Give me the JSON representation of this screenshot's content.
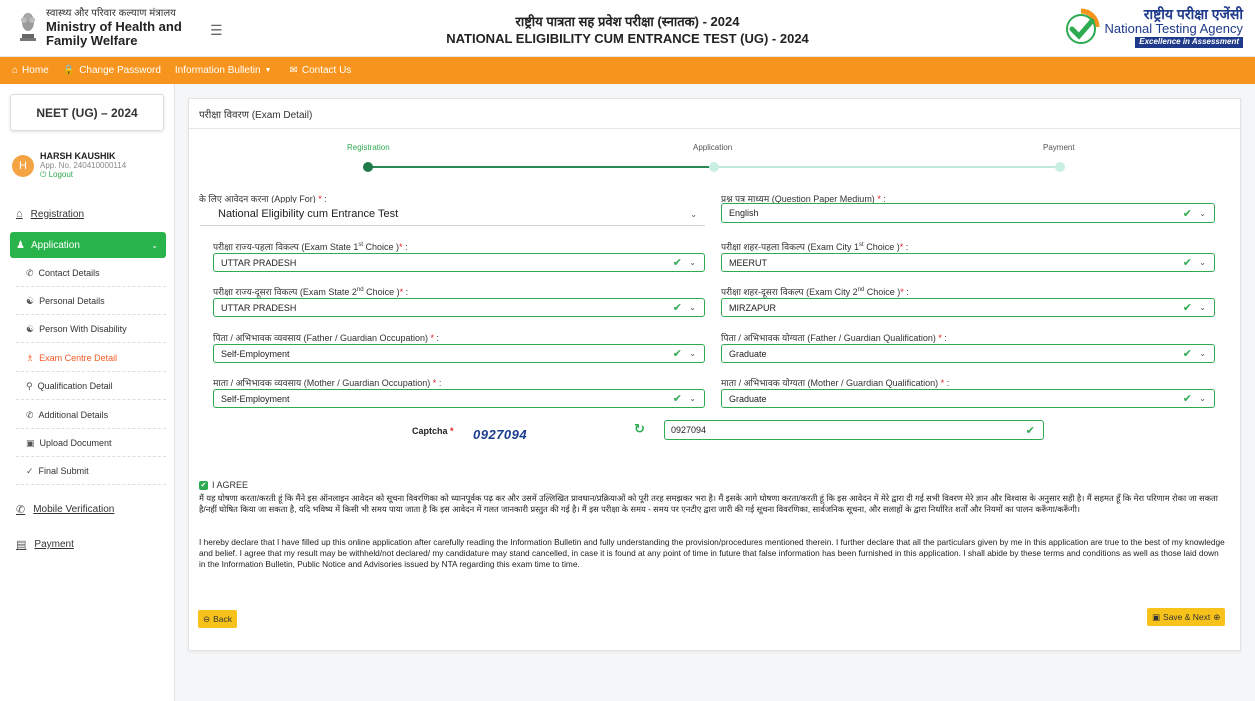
{
  "header": {
    "ministry_hindi": "स्वास्थ्य और परिवार कल्याण मंत्रालय",
    "ministry_line1": "Ministry of Health and",
    "ministry_line2": "Family Welfare",
    "title_hindi": "राष्ट्रीय पात्रता सह प्रवेश परीक्षा (स्नातक) - 2024",
    "title_en": "NATIONAL ELIGIBILITY CUM ENTRANCE TEST (UG) - 2024",
    "nta_hindi": "राष्ट्रीय परीक्षा एजेंसी",
    "nta_en": "National Testing Agency",
    "nta_tagline": "Excellence in Assessment"
  },
  "nav": {
    "home": "Home",
    "change_password": "Change Password",
    "info_bulletin": "Information Bulletin",
    "contact_us": "Contact Us"
  },
  "sidebar": {
    "exam_title": "NEET (UG) – 2024",
    "user_initial": "H",
    "user_name": "HARSH KAUSHIK",
    "app_no": "App. No. 240410000114",
    "logout": "Logout",
    "registration": "Registration",
    "application": "Application",
    "sub_items": [
      "Contact Details",
      "Personal Details",
      "Person With Disability",
      "Exam Centre Detail",
      "Qualification Detail",
      "Additional Details",
      "Upload Document",
      "Final Submit"
    ],
    "mobile_verification": "Mobile Verification",
    "payment": "Payment"
  },
  "card": {
    "title": "परीक्षा विवरण (Exam Detail)"
  },
  "steps": {
    "registration": "Registration",
    "application": "Application",
    "payment": "Payment"
  },
  "form": {
    "apply_for_label": "के लिए आवेदन करना (Apply For)",
    "apply_for_value": "National Eligibility cum Entrance Test",
    "medium_label": "प्रश्न पत्र माध्यम (Question Paper Medium)",
    "medium_value": "English",
    "state1_label_pre": "परीक्षा राज्य-पहला विकल्प (Exam State 1",
    "state1_sup": "st",
    "state1_label_post": " Choice )",
    "state1_value": "UTTAR PRADESH",
    "city1_label_pre": "परीक्षा शहर-पहला विकल्प (Exam City 1",
    "city1_sup": "st",
    "city1_label_post": " Choice )",
    "city1_value": "MEERUT",
    "state2_label_pre": "परीक्षा राज्य-दूसरा विकल्प (Exam State 2",
    "state2_sup": "nd",
    "state2_label_post": " Choice )",
    "state2_value": "UTTAR PRADESH",
    "city2_label_pre": "परीक्षा शहर-दूसरा विकल्प (Exam City 2",
    "city2_sup": "nd",
    "city2_label_post": " Choice )",
    "city2_value": "MIRZAPUR",
    "father_occ_label": "पिता / अभिभावक व्यवसाय (Father / Guardian Occupation)",
    "father_occ_value": "Self-Employment",
    "father_qual_label": "पिता / अभिभावक योग्यता (Father / Guardian Qualification)",
    "father_qual_value": "Graduate",
    "mother_occ_label": "माता / अभिभावक व्यवसाय (Mother / Guardian Occupation)",
    "mother_occ_value": "Self-Employment",
    "mother_qual_label": "माता / अभिभावक योग्यता (Mother / Guardian Qualification)",
    "mother_qual_value": "Graduate",
    "required_mark": "*",
    "colon": " :",
    "captcha_label": "Captcha",
    "captcha_text": "0927094",
    "captcha_value": "0927094"
  },
  "declaration": {
    "agree_label": "I AGREE",
    "hindi": "मैं यह घोषणा करता/करती हूं कि मैंने इस ऑनलाइन आवेदन को सूचना विवरणिका को ध्यानपूर्वक पढ़ कर और उसमें उल्लिखित प्रावधान/प्रक्रियाओं को पूरी तरह समझकर भरा है। मैं इसके आगे घोषणा करता/करती हूं कि इस आवेदन में मेरे द्वारा दी गई सभी विवरण मेरे ज्ञान और विश्वास के अनुसार सही है। मैं सहमत हूँ कि मेरा परिणाम रोका जा सकता है/नहीं घोषित किया जा सकता है, यदि भविष्य में किसी भी समय पाया जाता है कि इस आवेदन में गलत जानकारी प्रस्तुत की गई है। मैं इस परीक्षा के समय - समय पर एनटीए द्वारा जारी की गई सूचना विवरणिका, सार्वजनिक सूचना, और सलाहों के द्वारा निर्धारित शर्तों और नियमों का पालन करूँगा/करूँगी।",
    "english": "I hereby declare that I have filled up this online application after carefully reading the Information Bulletin and fully understanding the provision/procedures mentioned therein. I further declare that all the particulars given by me in this application are true to the best of my knowledge and belief. I agree that my result may be withheld/not declared/ my candidature may stand cancelled, in case it is found at any point of time in future that false information has been furnished in this application. I shall abide by these terms and conditions as well as those laid down in the Information Bulletin, Public Notice and Advisories issued by NTA regarding this exam time to time."
  },
  "buttons": {
    "back": "Back",
    "save_next": "Save & Next"
  },
  "colors": {
    "orange": "#f7941d",
    "green": "#2eaa51",
    "yellow": "#f7c31a",
    "active_sub": "#f15a24"
  }
}
